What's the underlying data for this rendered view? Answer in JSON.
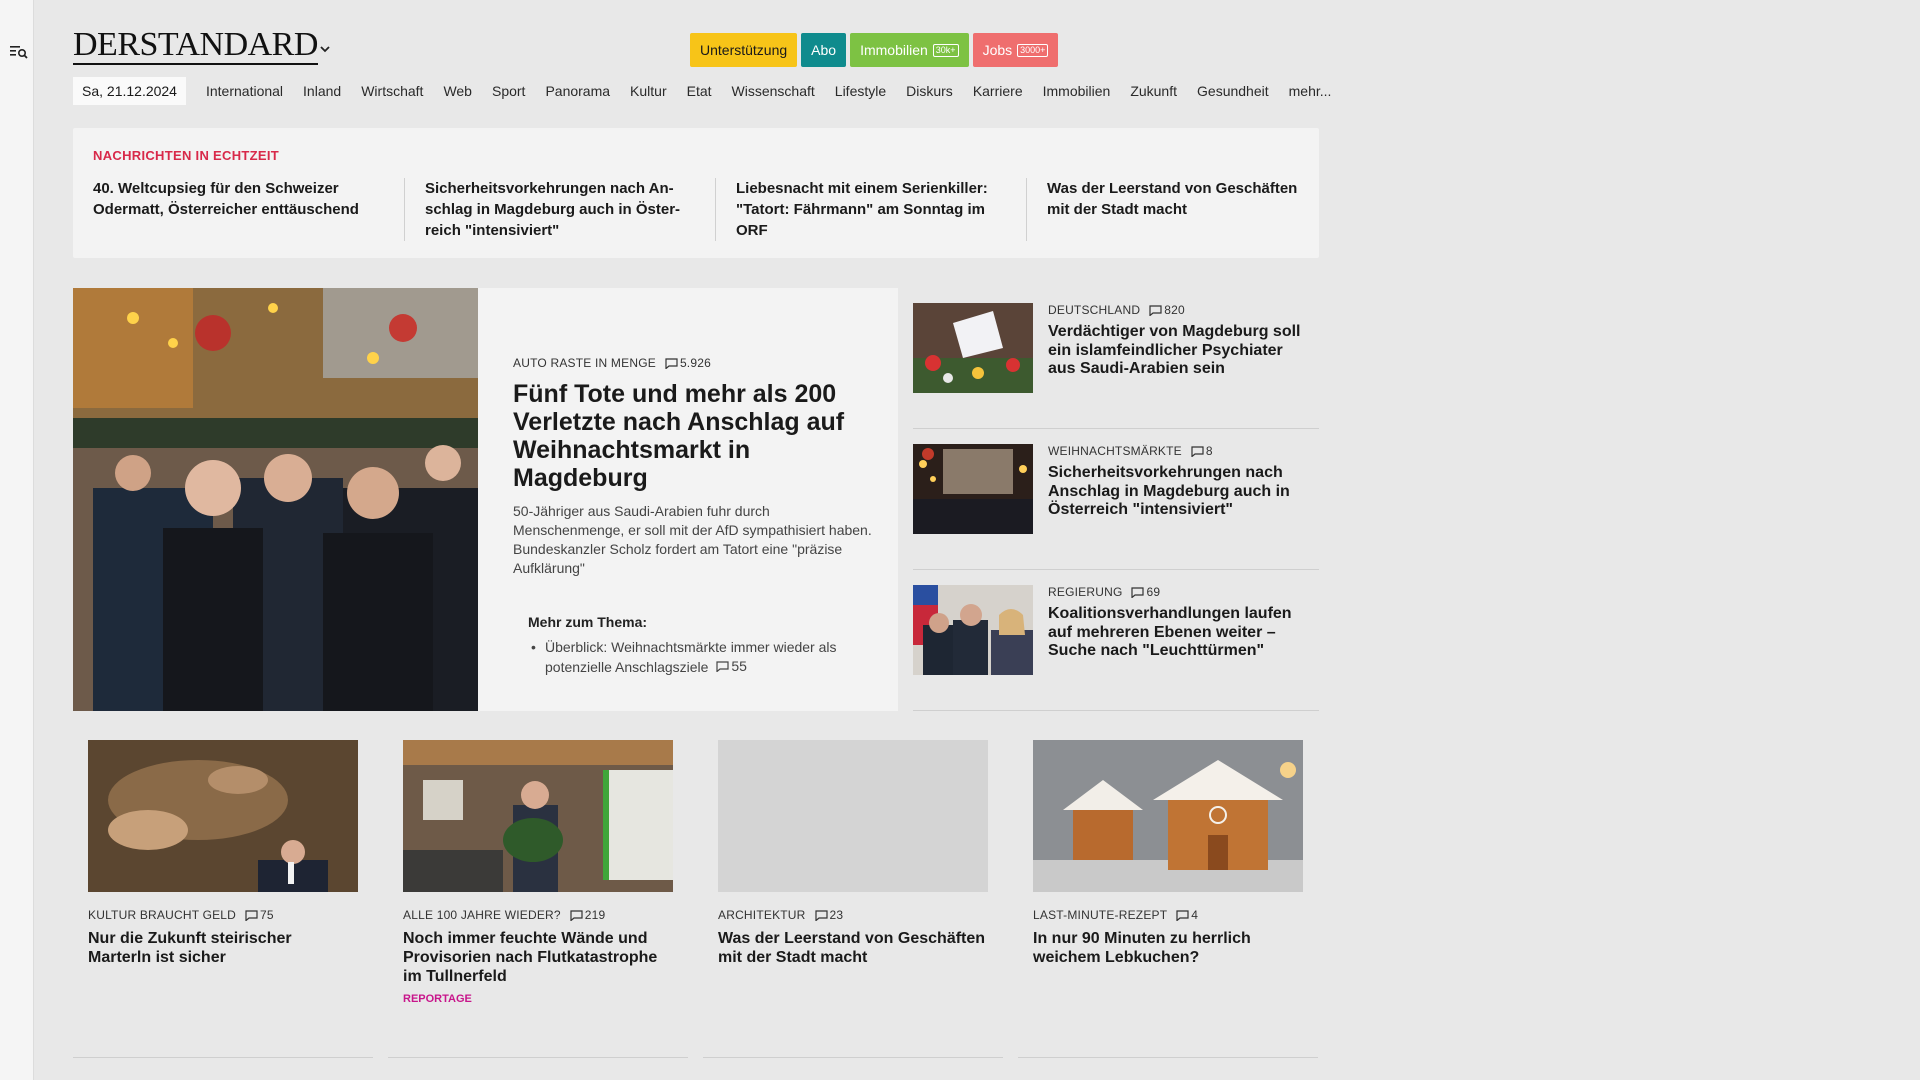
{
  "site": {
    "logo": "DERSTANDARD"
  },
  "top_buttons": {
    "support": "Unterstützung",
    "abo": "Abo",
    "immobilien": "Immobilien",
    "immobilien_badge": "30k+",
    "jobs": "Jobs",
    "jobs_badge": "3000+"
  },
  "nav": {
    "date": "Sa, 21.12.2024",
    "items": [
      "International",
      "Inland",
      "Wirtschaft",
      "Web",
      "Sport",
      "Panorama",
      "Kultur",
      "Etat",
      "Wissenschaft",
      "Lifestyle",
      "Diskurs",
      "Karriere",
      "Immobilien",
      "Zukunft",
      "Gesundheit",
      "mehr..."
    ]
  },
  "ticker": {
    "label": "NACHRICHTEN IN ECHTZEIT",
    "items": [
      "40. Weltcupsieg für den Schweizer Odermatt, Österreicher enttäuschend",
      "Sicherheitsvorkehrungen nach An­schlag in Magdeburg auch in Öster­reich \"intensiviert\"",
      "Liebesnacht mit einem Serienkiller: \"Tatort: Fährmann\" am Sonntag im ORF",
      "Was der Leerstand von Geschäften mit der Stadt macht"
    ]
  },
  "lead": {
    "kicker": "AUTO RASTE IN MENGE",
    "comments": "5.926",
    "title": "Fünf Tote und mehr als 200 Verletzte nach Anschlag auf Weihnachtsmarkt in Magdeburg",
    "teaser": "50-Jähriger aus Saudi-Arabien fuhr durch Menschenmenge, er soll mit der AfD sympathisiert haben. Bundeskanzler Scholz fordert am Tatort eine \"präzise Aufklärung\"",
    "more_heading": "Mehr zum Thema:",
    "more_item": "Überblick: Weihnachtsmärkte immer wieder als potenzielle Anschlagsziele",
    "more_comments": "55"
  },
  "side": [
    {
      "kicker": "DEUTSCHLAND",
      "comments": "820",
      "title": "Verdächtiger von Magdeburg soll ein islamfeindlicher Psychiater aus Saudi-Arabien sein"
    },
    {
      "kicker": "WEIHNACHTSMÄRKTE",
      "comments": "8",
      "title": "Sicherheitsvorkehrungen nach Anschlag in Magdeburg auch in Österreich \"intensiviert\""
    },
    {
      "kicker": "REGIERUNG",
      "comments": "69",
      "title": "Koalitionsverhandlungen laufen auf mehreren Ebenen weiter – Suche nach \"Leuchttürmen\""
    }
  ],
  "cards": [
    {
      "kicker": "KULTUR BRAUCHT GELD",
      "comments": "75",
      "title": "Nur die Zukunft steirischer Marterln ist sicher",
      "tag": ""
    },
    {
      "kicker": "ALLE 100 JAHRE WIEDER?",
      "comments": "219",
      "title": "Noch immer feuchte Wände und Provisorien nach Flutkatastrophe im Tullnerfeld",
      "tag": "REPORTAGE"
    },
    {
      "kicker": "ARCHITEKTUR",
      "comments": "23",
      "title": "Was der Leerstand von Geschäften mit der Stadt macht",
      "tag": ""
    },
    {
      "kicker": "LAST-MINUTE-REZEPT",
      "comments": "4",
      "title": "In nur 90 Minuten zu herrlich weichem Lebkuchen?",
      "tag": ""
    }
  ],
  "colors": {
    "ticker_label": "#d8294a",
    "support": "#f7c418",
    "abo": "#0f8b8d",
    "immobilien": "#7dc243",
    "jobs": "#ef6e6e",
    "reportage": "#c8168b"
  }
}
